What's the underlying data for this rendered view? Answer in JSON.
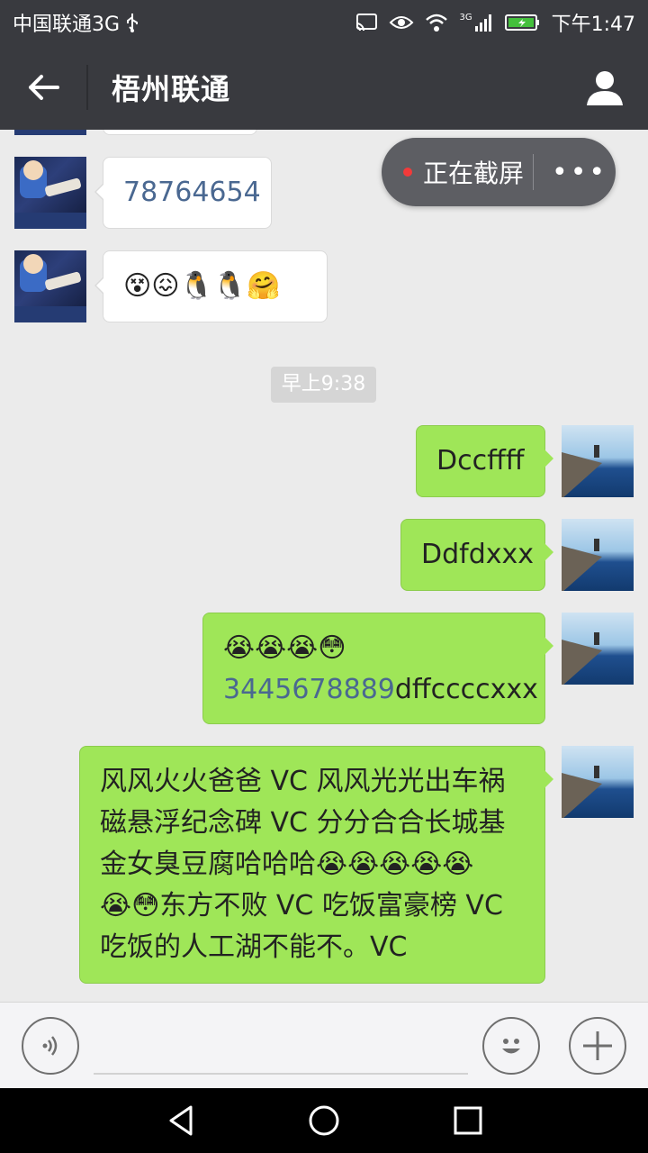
{
  "status_bar": {
    "carrier": "中国联通3G",
    "network_tag": "3G",
    "time": "下午1:47"
  },
  "header": {
    "title": "梧州联通",
    "back_icon": "arrow-left-icon",
    "contact_icon": "person-icon"
  },
  "screenshot_pill": {
    "label": "正在截屏",
    "more": "•••"
  },
  "messages": {
    "m1_text": "78764654",
    "m2_emojis": [
      "😵",
      "😖",
      "🐧",
      "🐧",
      "🤗"
    ],
    "timestamp": "早上9:38",
    "m3_text": "Dccffff",
    "m4_text": "Ddfdxxx",
    "m5_emojis": [
      "😭",
      "😭",
      "😭",
      "😳"
    ],
    "m5_number": "3445678889",
    "m5_suffix": "dffccccxxx",
    "m6_line1": "风风火火爸爸 VC 风风光光出车祸",
    "m6_line2": "磁悬浮纪念碑 VC 分分合合长城基",
    "m6_line3": "金女臭豆腐哈哈哈",
    "m6_line3_emojis": [
      "😭",
      "😭",
      "😭",
      "😭",
      "😭"
    ],
    "m6_line4_emojis": [
      "😭",
      "😳"
    ],
    "m6_line4": "东方不败 VC 吃饭富豪榜 VC",
    "m6_line5": "吃饭的人工湖不能不。VC"
  },
  "input_bar": {
    "voice_icon": "voice-icon",
    "emoji_icon": "smiley-icon",
    "plus_icon": "plus-icon",
    "value": ""
  },
  "colors": {
    "header_bg": "#393a3f",
    "chat_bg": "#ebebeb",
    "bubble_green": "#9fe658",
    "link_blue": "#4a6891"
  }
}
